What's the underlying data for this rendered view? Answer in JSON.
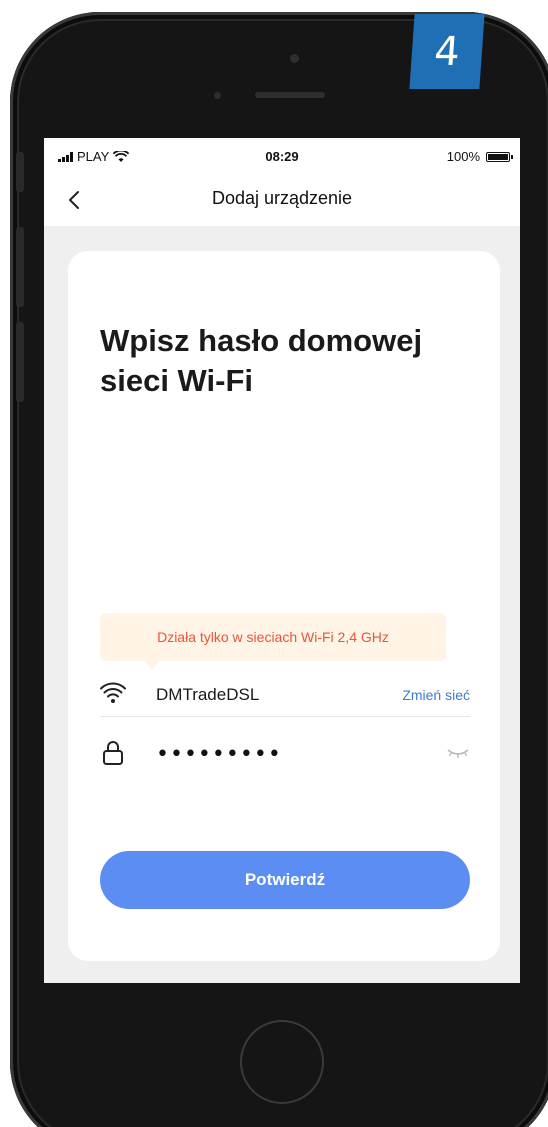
{
  "step_badge": "4",
  "status_bar": {
    "carrier": "PLAY",
    "time": "08:29",
    "battery": "100%"
  },
  "nav": {
    "back_icon": "chevron-left-icon",
    "title": "Dodaj urządzenie"
  },
  "card": {
    "title": "Wpisz hasło domowej sieci Wi-Fi",
    "warning": "Działa tylko w sieciach Wi-Fi 2,4 GHz",
    "network": {
      "icon": "wifi-icon",
      "ssid": "DMTradeDSL",
      "change_label": "Zmień sieć"
    },
    "password": {
      "icon": "lock-icon",
      "value": "•••••••••",
      "visibility_icon": "eye-closed-icon"
    },
    "confirm_label": "Potwierdź"
  },
  "colors": {
    "accent": "#5b8df2",
    "link": "#3a7bd5",
    "warning_text": "#e8553c",
    "warning_bg": "#fff4e6",
    "badge": "#1f6fb5"
  }
}
